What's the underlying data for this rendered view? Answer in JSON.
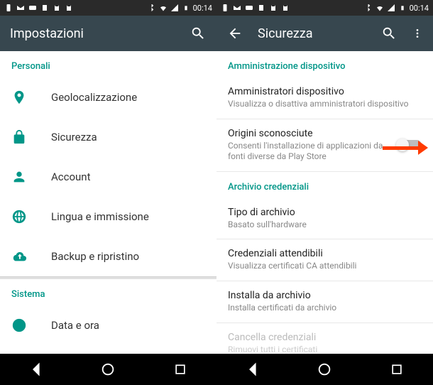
{
  "status": {
    "time": "00:14"
  },
  "left": {
    "title": "Impostazioni",
    "section_personal": "Personali",
    "items": [
      {
        "label": "Geolocalizzazione"
      },
      {
        "label": "Sicurezza"
      },
      {
        "label": "Account"
      },
      {
        "label": "Lingua e immissione"
      },
      {
        "label": "Backup e ripristino"
      }
    ],
    "section_system": "Sistema",
    "system_items": [
      {
        "label": "Data e ora"
      }
    ]
  },
  "right": {
    "title": "Sicurezza",
    "section_admin": "Amministrazione dispositivo",
    "admin": {
      "title": "Amministratori dispositivo",
      "sub": "Visualizza o disattiva amministratori dispositivo"
    },
    "unknown": {
      "title": "Origini sconosciute",
      "sub": "Consenti l'installazione di applicazioni da fonti diverse da Play Store"
    },
    "section_cred": "Archivio credenziali",
    "storage": {
      "title": "Tipo di archivio",
      "sub": "Basato sull'hardware"
    },
    "trusted": {
      "title": "Credenziali attendibili",
      "sub": "Visualizza certificati CA attendibili"
    },
    "install": {
      "title": "Installa da archivio",
      "sub": "Installa certificati da archivio"
    },
    "clear": {
      "title": "Cancella credenziali",
      "sub": "Rimuovi tutti i certificati"
    }
  }
}
